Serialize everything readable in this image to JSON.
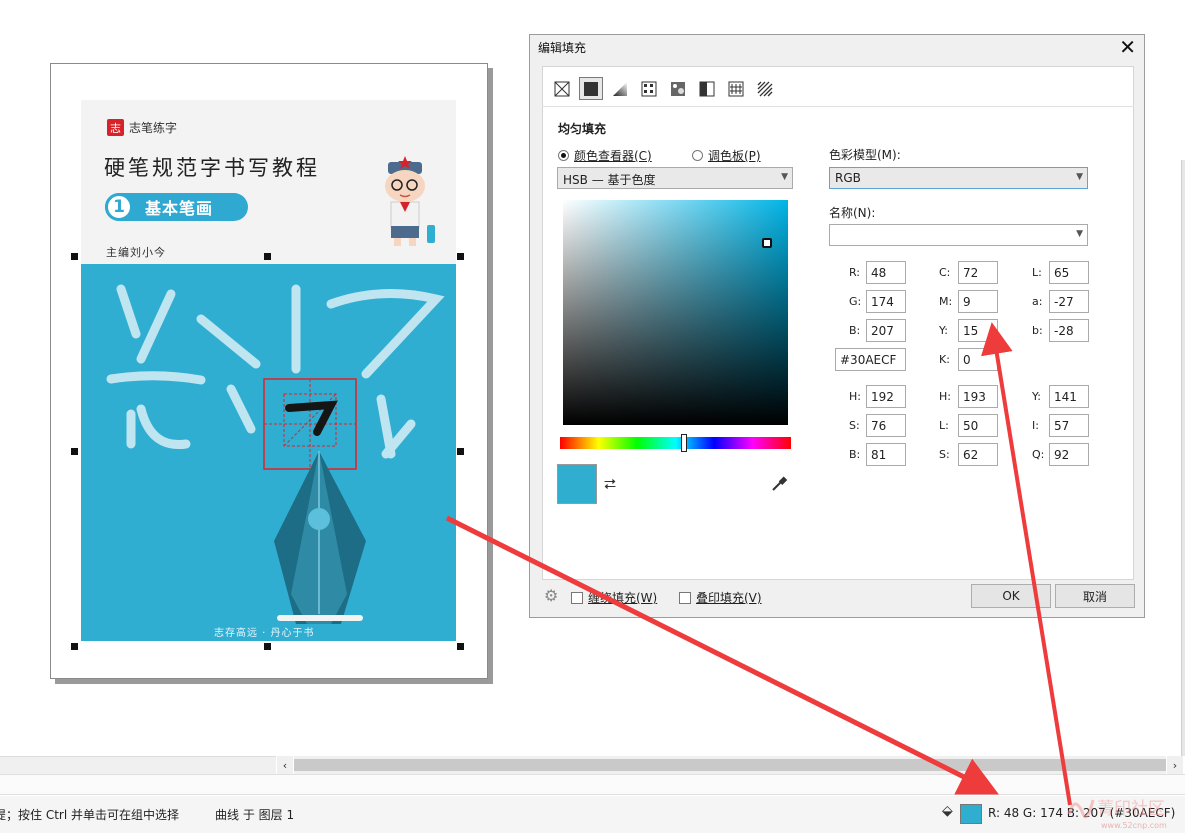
{
  "book": {
    "brand": "志笔练字",
    "brand_mark": "志",
    "title": "硬笔规范字书写教程",
    "volume_number": "1",
    "volume_label": "基本笔画",
    "editor": "主编刘小今",
    "slogan": "志存高远 · 丹心于书"
  },
  "dialog": {
    "title": "编辑填充",
    "close_icon": "close-icon",
    "tabs": [
      {
        "name": "no-fill-icon",
        "active": false
      },
      {
        "name": "uniform-fill-icon",
        "active": true
      },
      {
        "name": "fountain-fill-icon",
        "active": false
      },
      {
        "name": "vector-pattern-icon",
        "active": false
      },
      {
        "name": "bitmap-pattern-icon",
        "active": false
      },
      {
        "name": "two-color-pattern-icon",
        "active": false
      },
      {
        "name": "texture-fill-icon",
        "active": false
      },
      {
        "name": "postscript-fill-icon",
        "active": false
      }
    ],
    "section_title": "均匀填充",
    "radio_viewer": "颜色查看器(C)",
    "radio_palette": "调色板(P)",
    "viewer_mode": "HSB — 基于色度",
    "color_model_label": "色彩模型(M):",
    "color_model": "RGB",
    "name_label": "名称(N):",
    "name_value": "",
    "rgb": {
      "R": "48",
      "G": "174",
      "B": "207"
    },
    "hex": "#30AECF",
    "cmyk": {
      "C": "72",
      "M": "9",
      "Y": "15",
      "K": "0"
    },
    "lab": {
      "L": "65",
      "a": "-27",
      "b": "-28"
    },
    "hsb": {
      "H": "192",
      "S": "76",
      "B": "81"
    },
    "hls": {
      "H": "193",
      "L": "50",
      "S": "62"
    },
    "yiq": {
      "Y": "141",
      "I": "57",
      "Q": "92"
    },
    "current_color": "#30AECF",
    "wrap_fill": "缠绕填充(W)",
    "overprint_fill": "叠印填充(V)",
    "ok": "OK",
    "cancel": "取消"
  },
  "status": {
    "hint": "提；按住 Ctrl 并单击可在组中选择",
    "object": "曲线 于 图层 1",
    "fill_color": "#30AECF",
    "readout": "R:   48 G:   174 B:   207 (#30AECF)"
  },
  "watermark": "菁印社区",
  "watermark_url": "www.52cnp.com",
  "colors": {
    "accent": "#30AECF",
    "annotation": "#e8333c",
    "brand_red": "#d8222a"
  }
}
